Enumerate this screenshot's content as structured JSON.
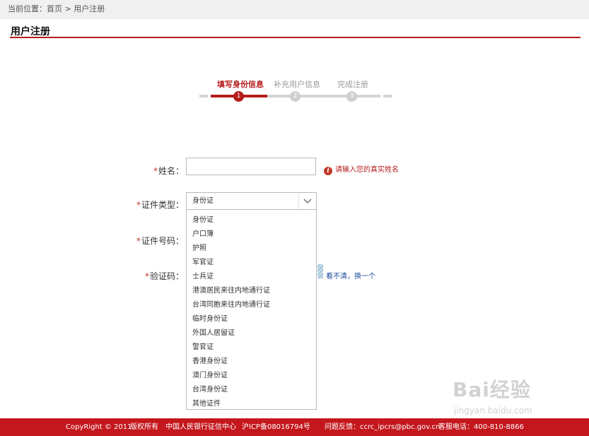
{
  "breadcrumb": {
    "prefix": "当前位置：",
    "home": "首页",
    "separator": ">",
    "current": "用户注册"
  },
  "page_title": "用户注册",
  "steps": [
    {
      "label": "填写身份信息",
      "number": "1",
      "active": true
    },
    {
      "label": "补充用户信息",
      "number": "2",
      "active": false
    },
    {
      "label": "完成注册",
      "number": "3",
      "active": false
    }
  ],
  "form": {
    "required_mark": "*",
    "name_label": "姓名：",
    "name_value": "",
    "name_hint": "请输入您的真实姓名",
    "id_type_label": "证件类型：",
    "id_type_selected": "身份证",
    "id_number_label": "证件号码：",
    "captcha_label": "验证码：",
    "captcha_refresh": "看不清，换一个",
    "id_type_options": [
      "身份证",
      "户口簿",
      "护照",
      "军官证",
      "士兵证",
      "港澳居民来往内地通行证",
      "台湾同胞来往内地通行证",
      "临时身份证",
      "外国人居留证",
      "警官证",
      "香港身份证",
      "澳门身份证",
      "台湾身份证",
      "其他证件"
    ]
  },
  "watermark": {
    "main": "Bai经验",
    "sub": "jingyan.baidu.com"
  },
  "footer": {
    "copyright": "CopyRight © 2011",
    "rights": "版权所有",
    "org": "中国人民银行征信中心",
    "icp": "沪ICP备08016794号",
    "feedback": "问题反馈：ccrc_ipcrs@pbc.gov.cn",
    "hotline": "客服电话：400-810-8866"
  },
  "colors": {
    "accent": "#b51c1c",
    "footer_bg": "#c4171d",
    "inactive": "#d4d4d4"
  }
}
